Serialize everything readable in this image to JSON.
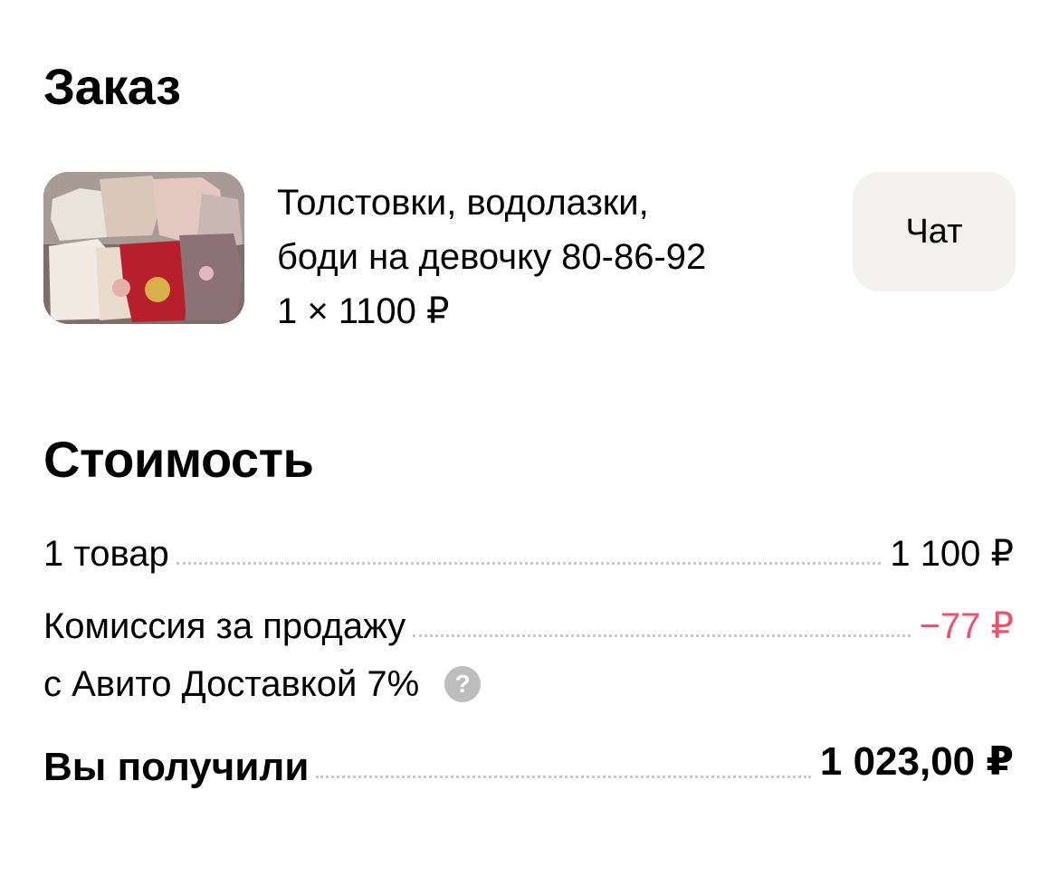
{
  "order": {
    "title": "Заказ",
    "product": {
      "image_name": "product-photo",
      "title_line1": "Толстовки, водолазки,",
      "title_line2": "боди на девочку 80-86-92",
      "qty_price": "1 × 1100 ₽"
    },
    "chat_label": "Чат"
  },
  "cost": {
    "title": "Стоимость",
    "items_label": "1 товар",
    "items_value": "1 100 ₽",
    "commission_label_line1": "Комиссия за продажу",
    "commission_label_line2": "с Авито Доставкой 7%",
    "commission_value": "−77 ₽",
    "commission_color": "#f2506a",
    "help_icon": "question-circle-icon",
    "help_symbol": "?",
    "total_label": "Вы получили",
    "total_value": "1 023,00 ₽"
  }
}
